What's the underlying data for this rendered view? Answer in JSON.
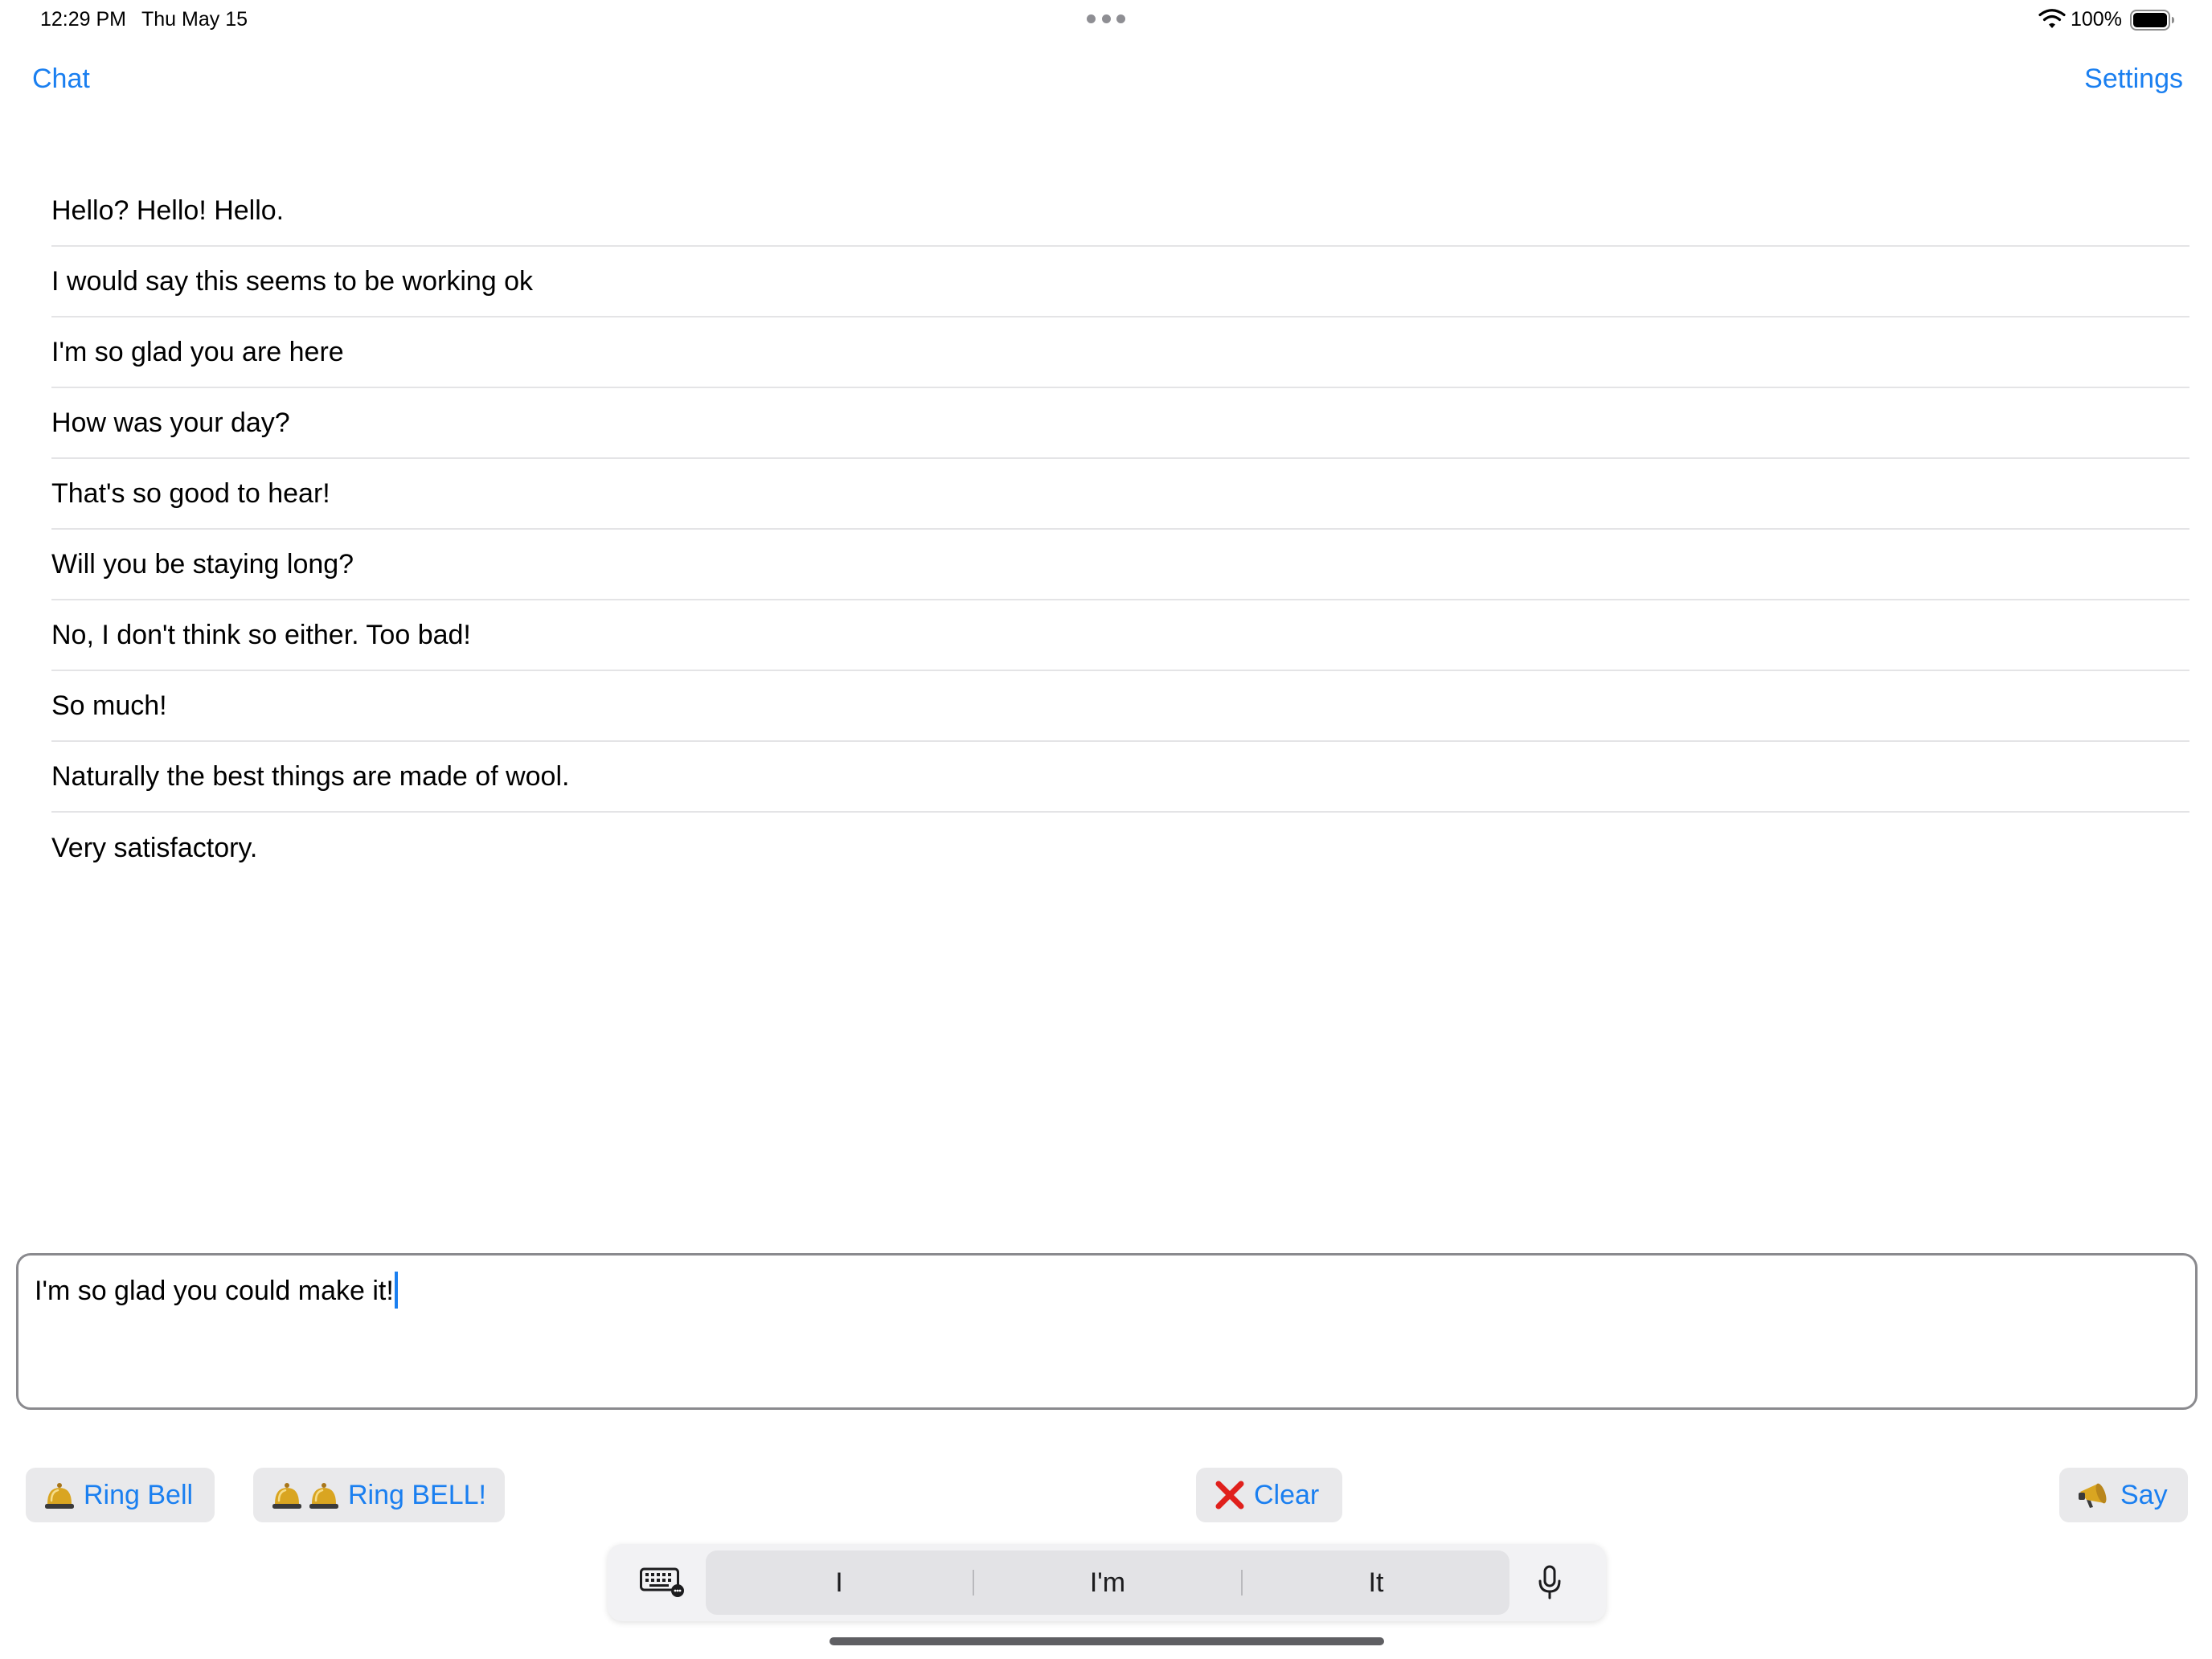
{
  "status_bar": {
    "time": "12:29 PM",
    "date": "Thu May 15",
    "battery_percent": "100%",
    "battery_level": 1.0,
    "icons": [
      "multitasking-dots-icon",
      "wifi-icon",
      "battery-icon"
    ]
  },
  "nav": {
    "left_label": "Chat",
    "right_label": "Settings"
  },
  "messages": [
    "Hello? Hello! Hello.",
    "I would say this seems to be working ok",
    "I'm so glad you are here",
    "How was your day?",
    "That's so good to hear!",
    "Will you be staying long?",
    "No, I don't think so either. Too bad!",
    "So much!",
    "Naturally the best things are made of wool.",
    "Very satisfactory."
  ],
  "input": {
    "value": "I'm so glad you could make it!"
  },
  "actions": {
    "ring_bell": {
      "icon": "bell-icon",
      "label": "Ring Bell"
    },
    "ring_bell_loud": {
      "icon": "double-bell-icon",
      "label": "Ring BELL!"
    },
    "clear": {
      "icon": "cross-mark-icon",
      "label": "Clear"
    },
    "say": {
      "icon": "megaphone-icon",
      "label": "Say"
    }
  },
  "keyboard_bar": {
    "suggestions": [
      "I",
      "I'm",
      "It"
    ],
    "icons": [
      "keyboard-icon",
      "microphone-icon"
    ]
  },
  "colors": {
    "accent": "#1a7ff0",
    "button_bg": "#e9e9eb",
    "clear_icon": "#e0201c",
    "bell_gold": "#d9a521"
  }
}
